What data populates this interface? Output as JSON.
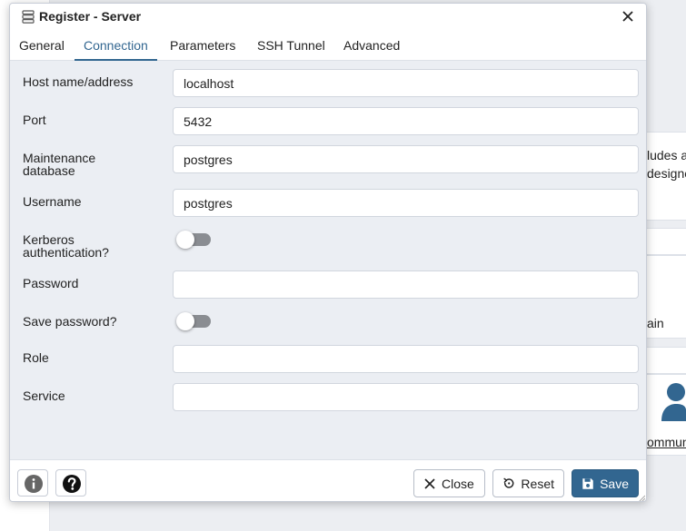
{
  "background": {
    "fragment_line1": "ludes a",
    "fragment_line2": "designe",
    "fragment_line3": "ain",
    "fragment_link": "ommun"
  },
  "dialog": {
    "title": "Register - Server",
    "tabs": [
      {
        "label": "General"
      },
      {
        "label": "Connection"
      },
      {
        "label": "Parameters"
      },
      {
        "label": "SSH Tunnel"
      },
      {
        "label": "Advanced"
      }
    ],
    "active_tab": "Connection"
  },
  "form": {
    "host": {
      "label": "Host name/address",
      "value": "localhost"
    },
    "port": {
      "label": "Port",
      "value": "5432"
    },
    "maintenance_db": {
      "label_line1": "Maintenance",
      "label_line2": "database",
      "value": "postgres"
    },
    "username": {
      "label": "Username",
      "value": "postgres"
    },
    "kerberos": {
      "label_line1": "Kerberos",
      "label_line2": "authentication?",
      "enabled": false
    },
    "password": {
      "label": "Password",
      "value": ""
    },
    "save_password": {
      "label": "Save password?",
      "enabled": false
    },
    "role": {
      "label": "Role",
      "value": ""
    },
    "service": {
      "label": "Service",
      "value": ""
    }
  },
  "footer": {
    "close_label": "Close",
    "reset_label": "Reset",
    "save_label": "Save"
  },
  "colors": {
    "accent": "#326690",
    "panel_bg": "#ebeef3",
    "toggle_off": "#8a8d92"
  }
}
